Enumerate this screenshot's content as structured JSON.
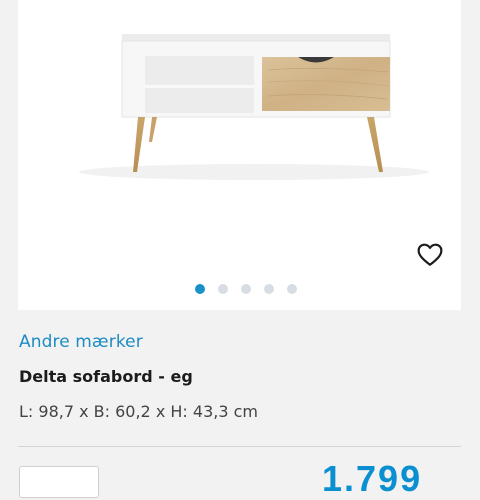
{
  "product": {
    "brand": "Andre mærker",
    "title": "Delta sofabord - eg",
    "dimensions": "L: 98,7 x B: 60,2 x H: 43,3 cm",
    "price": "1.799"
  },
  "gallery": {
    "image_count": 5,
    "active_index": 0,
    "wishlist_icon": "heart-outline-icon"
  },
  "colors": {
    "brand_link": "#1b8cc4",
    "price": "#0a8fd0",
    "active_dot": "#1891c9",
    "inactive_dot": "#d7dde2"
  }
}
